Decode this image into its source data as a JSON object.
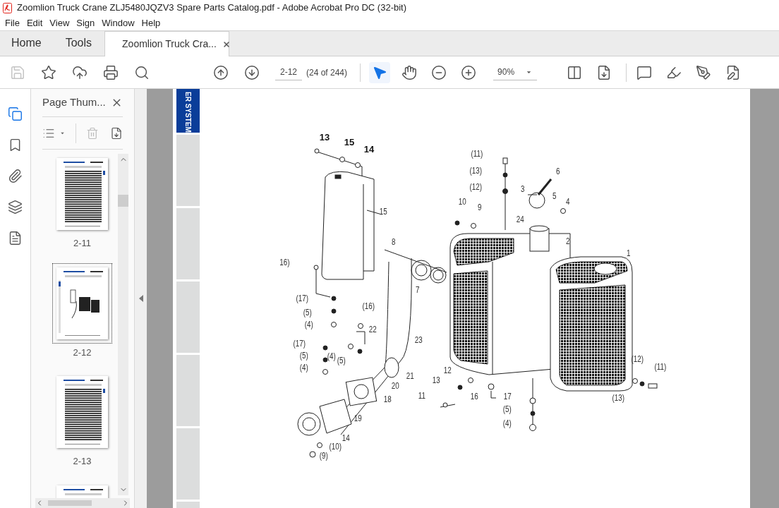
{
  "window": {
    "title": "Zoomlion Truck Crane ZLJ5480JQZV3 Spare Parts Catalog.pdf - Adobe Acrobat Pro DC (32-bit)"
  },
  "menu": [
    "File",
    "Edit",
    "View",
    "Sign",
    "Window",
    "Help"
  ],
  "tabs": [
    {
      "label": "Home",
      "selected": false,
      "kind": "nav"
    },
    {
      "label": "Tools",
      "selected": false,
      "kind": "nav"
    },
    {
      "label": "Zoomlion Truck Cra...",
      "selected": true,
      "kind": "document"
    }
  ],
  "toolbar": {
    "page_field": "2-12",
    "page_count": "(24 of 244)",
    "zoom": "90%",
    "tools": [
      {
        "kind": "save",
        "disabled": true,
        "selected": false
      },
      {
        "kind": "star",
        "disabled": false,
        "selected": false
      },
      {
        "kind": "upload",
        "disabled": false,
        "selected": false
      },
      {
        "kind": "print",
        "disabled": false,
        "selected": false
      },
      {
        "kind": "search",
        "disabled": false,
        "selected": false
      },
      {
        "kind": "prev",
        "disabled": false,
        "selected": false
      },
      {
        "kind": "next",
        "disabled": false,
        "selected": false
      },
      {
        "kind": "pointer",
        "disabled": false,
        "selected": true
      },
      {
        "kind": "hand",
        "disabled": false,
        "selected": false
      },
      {
        "kind": "zoomout",
        "disabled": false,
        "selected": false
      },
      {
        "kind": "zoomin",
        "disabled": false,
        "selected": false
      },
      {
        "kind": "fit",
        "disabled": false,
        "selected": false
      },
      {
        "kind": "scroll",
        "disabled": false,
        "selected": false
      },
      {
        "kind": "comment",
        "disabled": false,
        "selected": false
      },
      {
        "kind": "highlight",
        "disabled": false,
        "selected": false
      },
      {
        "kind": "sign",
        "disabled": false,
        "selected": false
      },
      {
        "kind": "edit",
        "disabled": false,
        "selected": false
      }
    ]
  },
  "rail": [
    {
      "kind": "pages",
      "selected": true
    },
    {
      "kind": "bookmarks",
      "selected": false
    },
    {
      "kind": "attachments",
      "selected": false
    },
    {
      "kind": "layers",
      "selected": false
    },
    {
      "kind": "content",
      "selected": false
    }
  ],
  "thumbnails_panel": {
    "title": "Page Thum...",
    "thumbnails": [
      {
        "label": "2-11",
        "selected": false,
        "kind": "table"
      },
      {
        "label": "2-12",
        "selected": true,
        "kind": "diagram"
      },
      {
        "label": "2-13",
        "selected": false,
        "kind": "table"
      },
      {
        "selected": false,
        "kind": "table"
      }
    ]
  },
  "document": {
    "side_tab": "ER SYSTEM",
    "callouts": [
      {
        "text": "13",
        "bold": true
      },
      {
        "text": "15",
        "bold": true
      },
      {
        "text": "14",
        "bold": true
      },
      {
        "text": "15",
        "bold": false
      },
      {
        "text": "8",
        "bold": false
      },
      {
        "text": "16)",
        "bold": false
      },
      {
        "text": "(17)",
        "bold": false
      },
      {
        "text": "(5)",
        "bold": false
      },
      {
        "text": "(4)",
        "bold": false
      },
      {
        "text": "(16)",
        "bold": false
      },
      {
        "text": "22",
        "bold": false
      },
      {
        "text": "(17)",
        "bold": false
      },
      {
        "text": "(5)",
        "bold": false
      },
      {
        "text": "(4)",
        "bold": false
      },
      {
        "text": "(4)",
        "bold": false
      },
      {
        "text": "(5)",
        "bold": false
      },
      {
        "text": "23",
        "bold": false
      },
      {
        "text": "21",
        "bold": false
      },
      {
        "text": "20",
        "bold": false
      },
      {
        "text": "18",
        "bold": false
      },
      {
        "text": "19",
        "bold": false
      },
      {
        "text": "14",
        "bold": false
      },
      {
        "text": "(10)",
        "bold": false
      },
      {
        "text": "(9)",
        "bold": false
      },
      {
        "text": "(11)",
        "bold": false
      },
      {
        "text": "(13)",
        "bold": false
      },
      {
        "text": "(12)",
        "bold": false
      },
      {
        "text": "6",
        "bold": false
      },
      {
        "text": "3",
        "bold": false
      },
      {
        "text": "5",
        "bold": false
      },
      {
        "text": "4",
        "bold": false
      },
      {
        "text": "10",
        "bold": false
      },
      {
        "text": "9",
        "bold": false
      },
      {
        "text": "24",
        "bold": false
      },
      {
        "text": "2",
        "bold": false
      },
      {
        "text": "1",
        "bold": false
      },
      {
        "text": "7",
        "bold": false
      },
      {
        "text": "12",
        "bold": false
      },
      {
        "text": "13",
        "bold": false
      },
      {
        "text": "11",
        "bold": false
      },
      {
        "text": "16",
        "bold": false
      },
      {
        "text": "17",
        "bold": false
      },
      {
        "text": "(5)",
        "bold": false
      },
      {
        "text": "(4)",
        "bold": false
      },
      {
        "text": "(12)",
        "bold": false
      },
      {
        "text": "(11)",
        "bold": false
      },
      {
        "text": "(13)",
        "bold": false
      }
    ]
  }
}
